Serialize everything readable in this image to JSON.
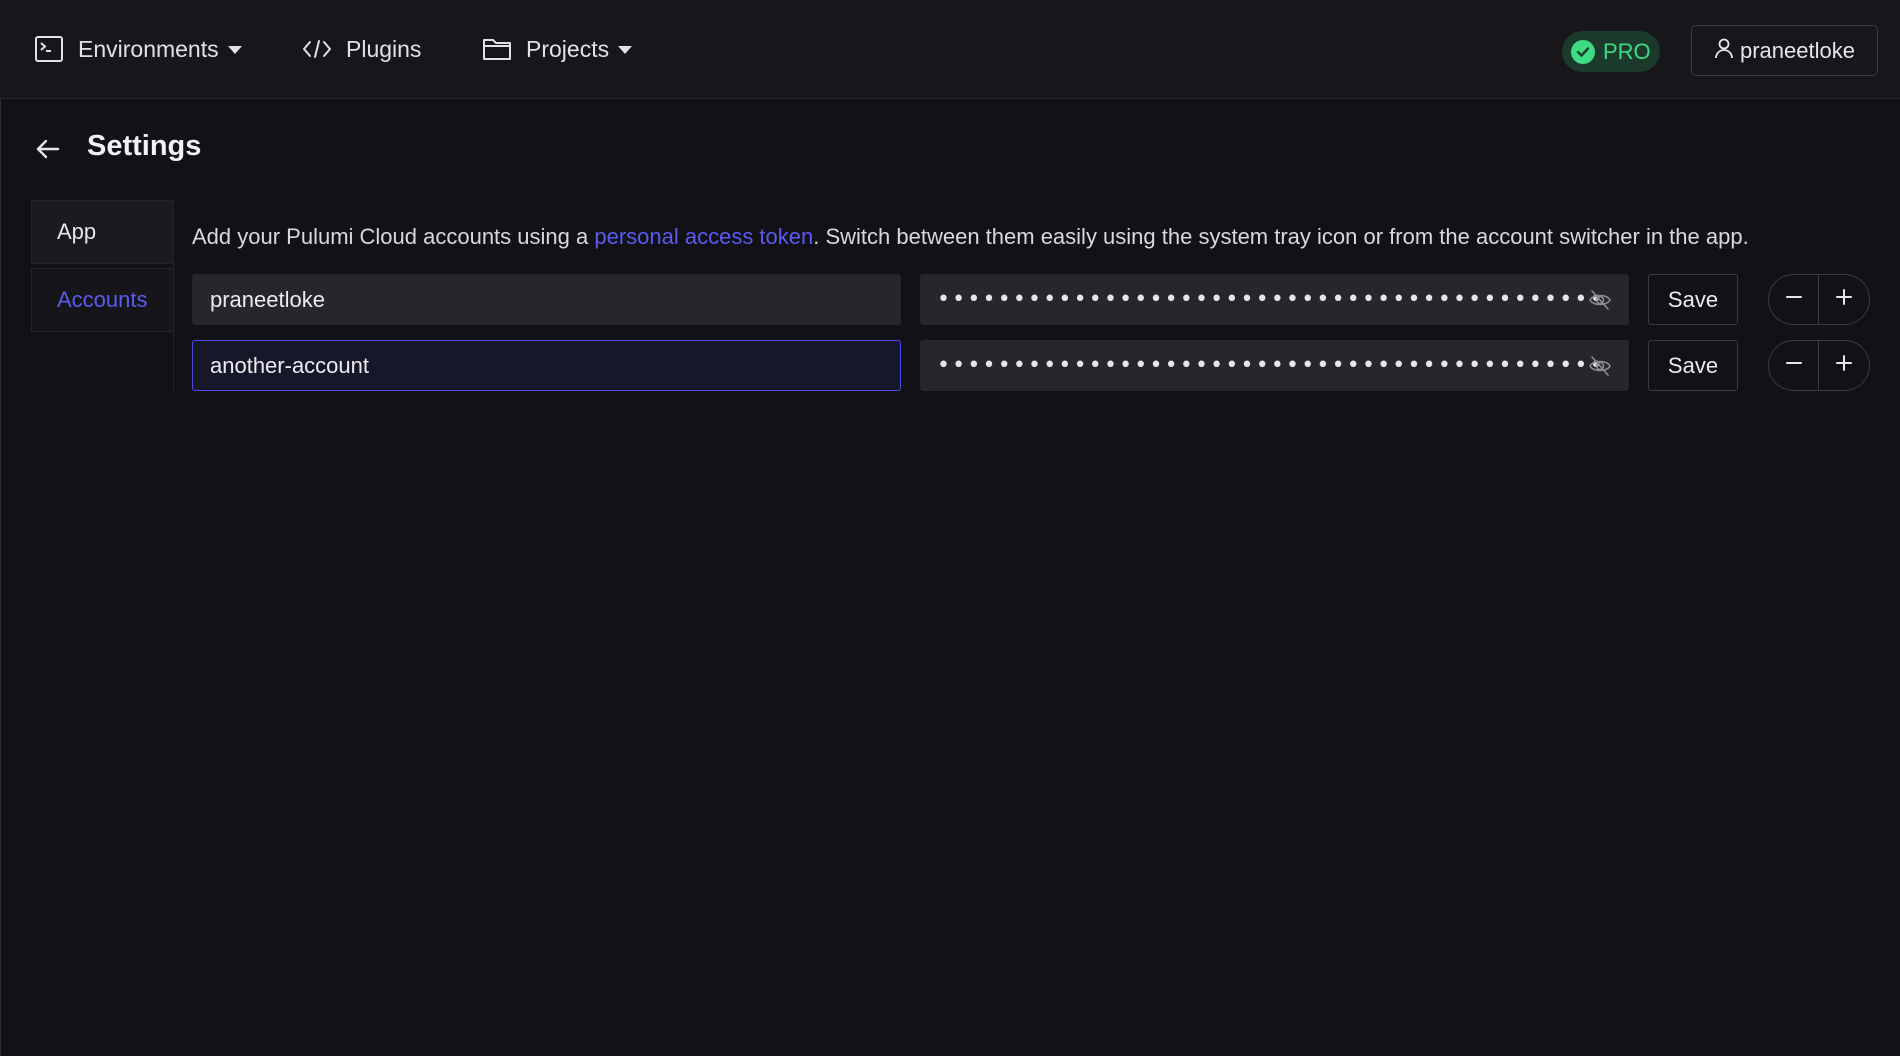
{
  "nav": {
    "environments_label": "Environments",
    "plugins_label": "Plugins",
    "projects_label": "Projects"
  },
  "badge": {
    "label": "PRO",
    "color": "#3ddc84"
  },
  "user": {
    "name": "praneetloke"
  },
  "page": {
    "title": "Settings"
  },
  "sidebar": {
    "items": [
      {
        "label": "App",
        "active": false
      },
      {
        "label": "Accounts",
        "active": true
      }
    ]
  },
  "accounts": {
    "description_before": "Add your Pulumi Cloud accounts using a ",
    "description_link": "personal access token",
    "description_after": ". Switch between them easily using the system tray icon or from the account switcher in the app.",
    "rows": [
      {
        "name": "praneetloke",
        "token_mask": "••••••••••••••••••••••••••••••••••••••••••••",
        "save_label": "Save"
      },
      {
        "name": "another-account",
        "token_mask": "••••••••••••••••••••••••••••••••••••••••••••",
        "save_label": "Save"
      }
    ]
  },
  "colors": {
    "accent": "#5b5bf0",
    "background": "#111116",
    "topbar": "#17171b",
    "input_bg": "#26262b"
  },
  "icons": {
    "environments": "terminal-icon",
    "plugins": "code-icon",
    "projects": "folder-icon",
    "user": "user-icon",
    "back": "arrow-left-icon",
    "eye": "eye-off-icon",
    "minus": "minus-icon",
    "plus": "plus-icon",
    "check": "check-circle-icon"
  }
}
